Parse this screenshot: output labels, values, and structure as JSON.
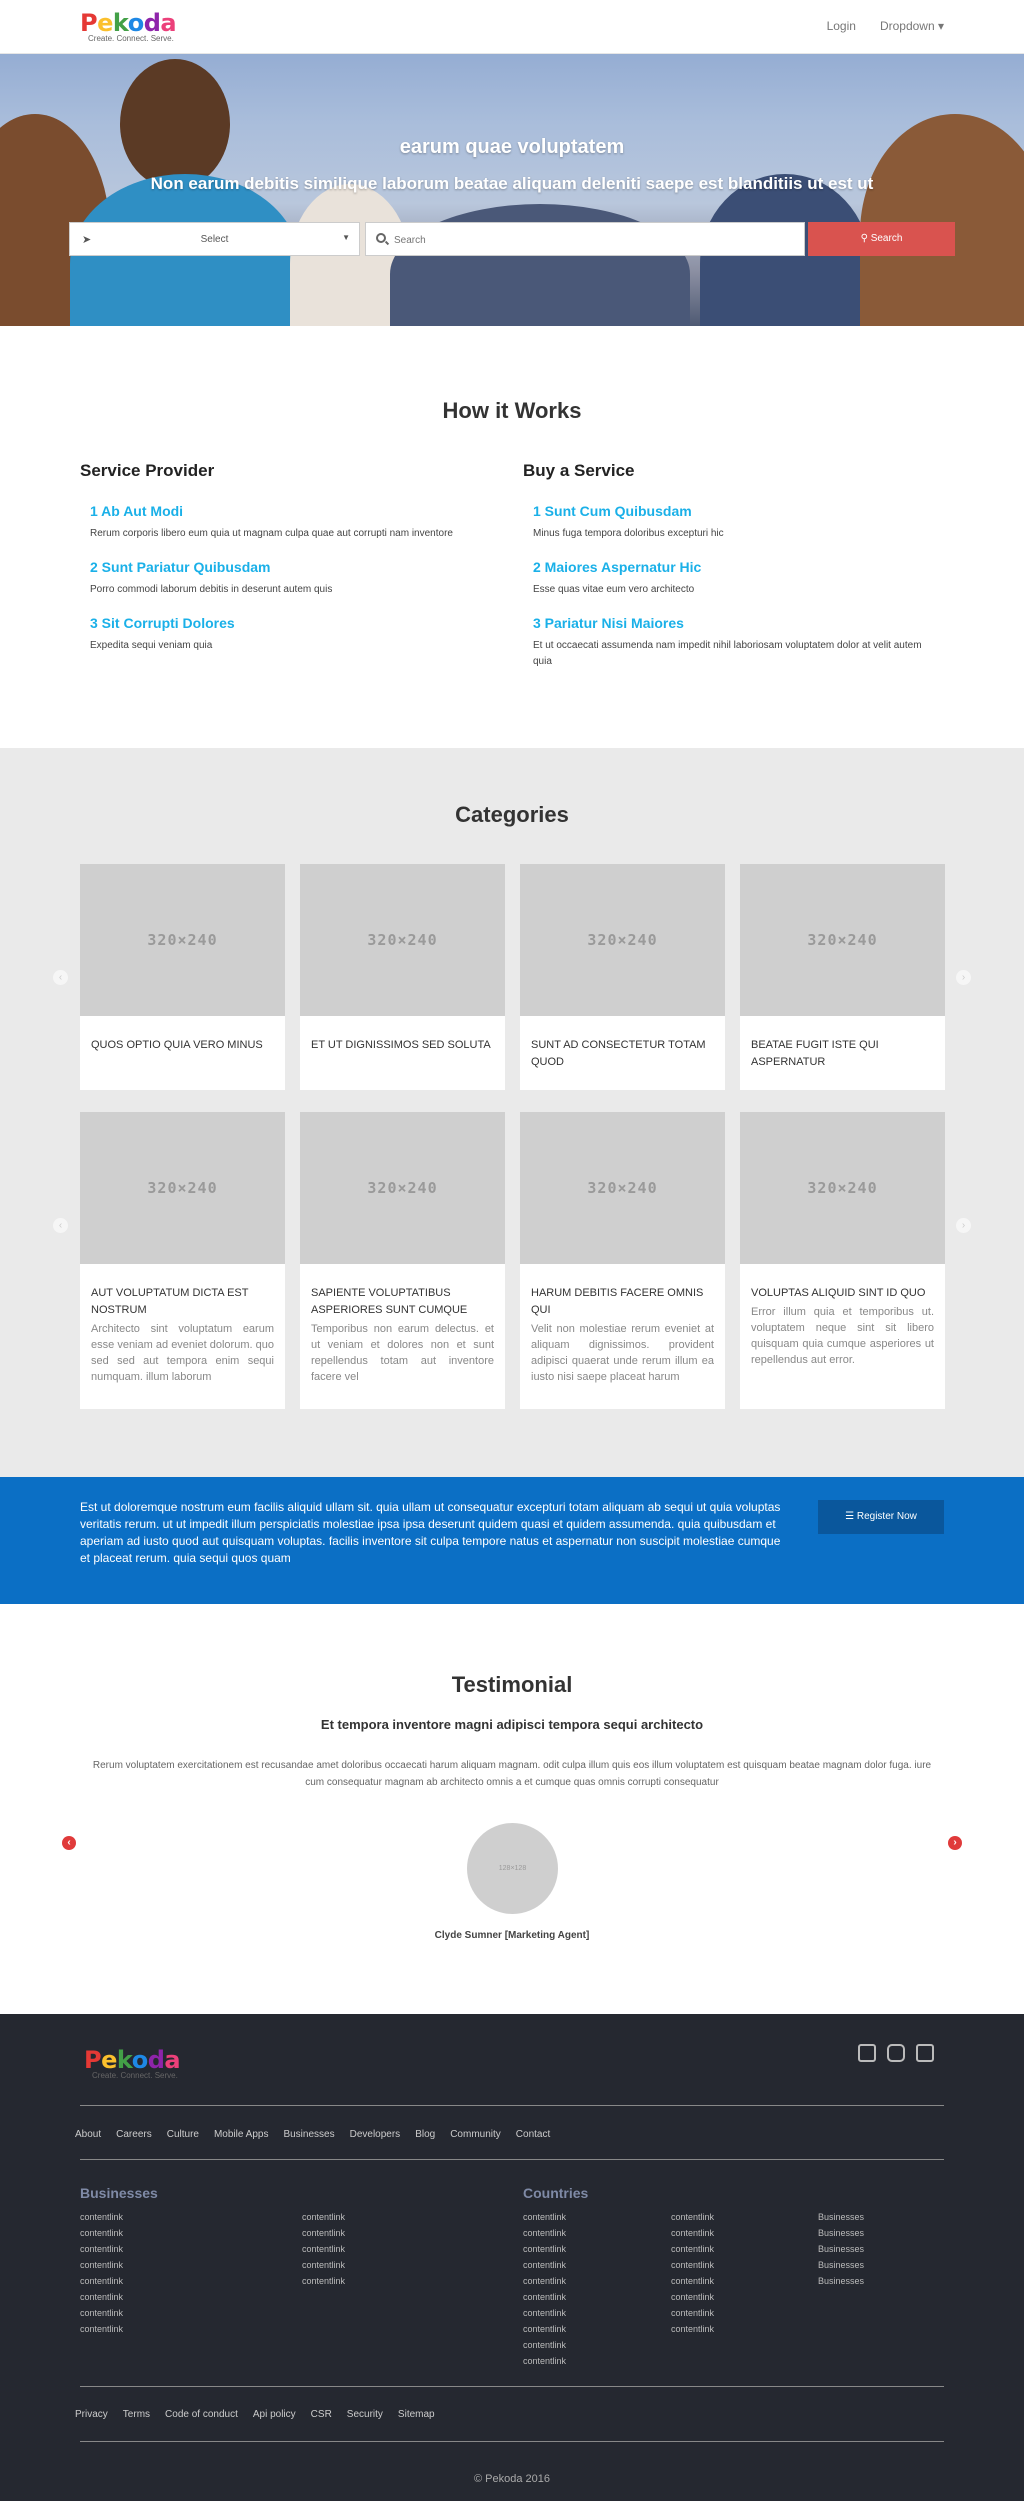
{
  "header": {
    "logo_letters": [
      {
        "ch": "P",
        "color": "#e53935"
      },
      {
        "ch": "e",
        "color": "#fbc02d"
      },
      {
        "ch": "k",
        "color": "#43a047"
      },
      {
        "ch": "o",
        "color": "#1e88e5"
      },
      {
        "ch": "d",
        "color": "#8e24aa"
      },
      {
        "ch": "a",
        "color": "#ec407a"
      }
    ],
    "logo_text": "Pekoda",
    "tagline": "Create. Connect. Serve.",
    "login": "Login",
    "dropdown": "Dropdown ▾"
  },
  "hero": {
    "title": "earum quae voluptatem",
    "subtitle": "Non earum debitis similique laborum beatae aliquam deleniti saepe est blanditiis ut est ut",
    "select_label": "Select",
    "search_placeholder": "Search",
    "search_button": "Search"
  },
  "how_it_works": {
    "title": "How it Works",
    "provider": {
      "heading": "Service Provider",
      "steps": [
        {
          "title": "1 Ab Aut Modi",
          "desc": "Rerum corporis libero eum quia ut magnam culpa quae aut corrupti nam inventore"
        },
        {
          "title": "2 Sunt Pariatur Quibusdam",
          "desc": "Porro commodi laborum debitis in deserunt autem quis"
        },
        {
          "title": "3 Sit Corrupti Dolores",
          "desc": "Expedita sequi veniam quia"
        }
      ]
    },
    "buyer": {
      "heading": "Buy a Service",
      "steps": [
        {
          "title": "1 Sunt Cum Quibusdam",
          "desc": "Minus fuga tempora doloribus excepturi hic"
        },
        {
          "title": "2 Maiores Aspernatur Hic",
          "desc": "Esse quas vitae eum vero architecto"
        },
        {
          "title": "3 Pariatur Nisi Maiores",
          "desc": "Et ut occaecati assumenda nam impedit nihil laboriosam voluptatem dolor at velit autem quia"
        }
      ]
    }
  },
  "categories": {
    "title": "Categories",
    "placeholder": "320×240",
    "row1": [
      {
        "title": "Quos optio quia vero minus",
        "desc": ""
      },
      {
        "title": "Et ut dignissimos sed soluta",
        "desc": ""
      },
      {
        "title": "Sunt ad consectetur totam quod",
        "desc": ""
      },
      {
        "title": "Beatae fugit iste qui aspernatur",
        "desc": ""
      }
    ],
    "row2": [
      {
        "title": "Aut voluptatum dicta est nostrum",
        "desc": "Architecto sint voluptatum earum esse veniam ad eveniet dolorum. quo sed sed aut tempora enim sequi numquam. illum laborum"
      },
      {
        "title": "Sapiente voluptatibus asperiores sunt cumque",
        "desc": "Temporibus non earum delectus. et ut veniam et dolores non et sunt repellendus totam aut inventore facere vel"
      },
      {
        "title": "Harum debitis facere omnis qui",
        "desc": "Velit non molestiae rerum eveniet at aliquam dignissimos. provident adipisci quaerat unde rerum illum ea iusto nisi saepe placeat harum"
      },
      {
        "title": "Voluptas aliquid sint id quo",
        "desc": "Error illum quia et temporibus ut. voluptatem neque sint sit libero quisquam quia cumque asperiores ut repellendus aut error."
      }
    ],
    "prev": "‹",
    "next": "›"
  },
  "cta": {
    "text": "Est ut doloremque nostrum eum facilis aliquid ullam sit. quia ullam ut consequatur excepturi totam aliquam ab sequi ut quia voluptas veritatis rerum. ut ut impedit illum perspiciatis molestiae ipsa ipsa deserunt quidem quasi et quidem assumenda. quia quibusdam et aperiam ad iusto quod aut quisquam voluptas. facilis inventore sit culpa tempore natus et aspernatur non suscipit molestiae cumque et placeat rerum. quia sequi quos quam",
    "button": "☰ Register Now"
  },
  "testimonial": {
    "title": "Testimonial",
    "subtitle": "Et tempora inventore magni adipisci tempora sequi architecto",
    "quote": "Rerum voluptatem exercitationem est recusandae amet doloribus occaecati harum aliquam magnam. odit culpa illum quis eos illum voluptatem est quisquam beatae magnam dolor fuga. iure cum consequatur magnam ab architecto omnis a et cumque quas omnis corrupti consequatur",
    "avatar_placeholder": "128×128",
    "name": "Clyde Sumner [Marketing Agent]",
    "prev": "‹",
    "next": "›"
  },
  "footer": {
    "nav": [
      "About",
      "Careers",
      "Culture",
      "Mobile Apps",
      "Businesses",
      "Developers",
      "Blog",
      "Community",
      "Contact"
    ],
    "businesses_heading": "Businesses",
    "businesses_col1": [
      "contentlink",
      "contentlink",
      "contentlink",
      "contentlink",
      "contentlink",
      "contentlink",
      "contentlink",
      "contentlink"
    ],
    "businesses_col2": [
      "contentlink",
      "contentlink",
      "contentlink",
      "contentlink",
      "contentlink"
    ],
    "countries_heading": "Countries",
    "countries_col1": [
      "contentlink",
      "contentlink",
      "contentlink",
      "contentlink",
      "contentlink",
      "contentlink",
      "contentlink",
      "contentlink",
      "contentlink",
      "contentlink"
    ],
    "countries_col2": [
      "contentlink",
      "contentlink",
      "contentlink",
      "contentlink",
      "contentlink",
      "contentlink",
      "contentlink",
      "contentlink"
    ],
    "countries_col3": [
      "Businesses",
      "Businesses",
      "Businesses",
      "Businesses",
      "Businesses"
    ],
    "bottom_links": [
      "Privacy",
      "Terms",
      "Code of conduct",
      "Api policy",
      "CSR",
      "Security",
      "Sitemap"
    ],
    "copyright": "© Pekoda 2016",
    "social_icons": [
      "twitter-icon",
      "instagram-icon",
      "facebook-icon"
    ]
  }
}
